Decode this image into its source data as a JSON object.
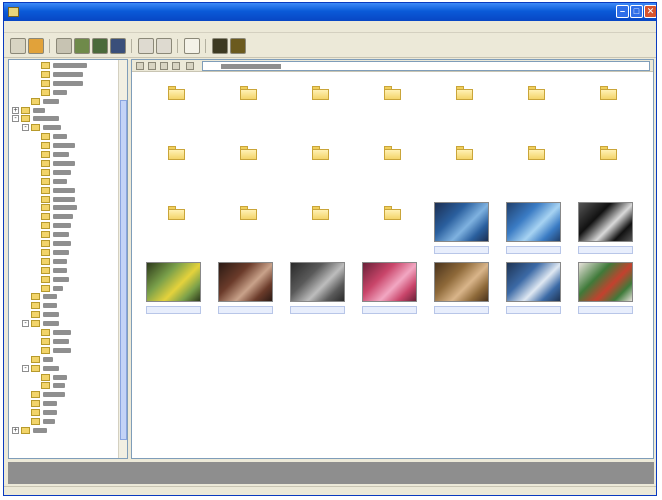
{
  "window": {
    "title": ""
  },
  "menu": [
    "",
    "",
    "",
    "",
    "",
    "",
    ""
  ],
  "address": {
    "path": ""
  },
  "tree": {
    "items": [
      {
        "depth": 3,
        "expander": ""
      },
      {
        "depth": 3,
        "expander": ""
      },
      {
        "depth": 3,
        "expander": ""
      },
      {
        "depth": 3,
        "expander": ""
      },
      {
        "depth": 2,
        "expander": ""
      },
      {
        "depth": 1,
        "expander": "+"
      },
      {
        "depth": 1,
        "expander": "-"
      },
      {
        "depth": 2,
        "expander": "-"
      },
      {
        "depth": 3,
        "expander": ""
      },
      {
        "depth": 3,
        "expander": ""
      },
      {
        "depth": 3,
        "expander": ""
      },
      {
        "depth": 3,
        "expander": ""
      },
      {
        "depth": 3,
        "expander": ""
      },
      {
        "depth": 3,
        "expander": ""
      },
      {
        "depth": 3,
        "expander": ""
      },
      {
        "depth": 3,
        "expander": ""
      },
      {
        "depth": 3,
        "expander": ""
      },
      {
        "depth": 3,
        "expander": ""
      },
      {
        "depth": 3,
        "expander": ""
      },
      {
        "depth": 3,
        "expander": ""
      },
      {
        "depth": 3,
        "expander": ""
      },
      {
        "depth": 3,
        "expander": ""
      },
      {
        "depth": 3,
        "expander": ""
      },
      {
        "depth": 3,
        "expander": ""
      },
      {
        "depth": 3,
        "expander": ""
      },
      {
        "depth": 3,
        "expander": ""
      },
      {
        "depth": 2,
        "expander": ""
      },
      {
        "depth": 2,
        "expander": ""
      },
      {
        "depth": 2,
        "expander": ""
      },
      {
        "depth": 2,
        "expander": "-"
      },
      {
        "depth": 3,
        "expander": ""
      },
      {
        "depth": 3,
        "expander": ""
      },
      {
        "depth": 3,
        "expander": ""
      },
      {
        "depth": 2,
        "expander": ""
      },
      {
        "depth": 2,
        "expander": "-"
      },
      {
        "depth": 3,
        "expander": ""
      },
      {
        "depth": 3,
        "expander": ""
      },
      {
        "depth": 2,
        "expander": ""
      },
      {
        "depth": 2,
        "expander": ""
      },
      {
        "depth": 2,
        "expander": ""
      },
      {
        "depth": 2,
        "expander": ""
      },
      {
        "depth": 1,
        "expander": "+"
      }
    ]
  },
  "files": [
    {
      "kind": "folder",
      "label": ""
    },
    {
      "kind": "folder",
      "label": ""
    },
    {
      "kind": "folder",
      "label": ""
    },
    {
      "kind": "folder",
      "label": ""
    },
    {
      "kind": "folder",
      "label": ""
    },
    {
      "kind": "folder",
      "label": ""
    },
    {
      "kind": "folder",
      "label": ""
    },
    {
      "kind": "folder",
      "label": ""
    },
    {
      "kind": "folder",
      "label": ""
    },
    {
      "kind": "folder",
      "label": ""
    },
    {
      "kind": "folder",
      "label": ""
    },
    {
      "kind": "folder",
      "label": ""
    },
    {
      "kind": "folder",
      "label": ""
    },
    {
      "kind": "folder",
      "label": ""
    },
    {
      "kind": "folder",
      "label": ""
    },
    {
      "kind": "folder",
      "label": ""
    },
    {
      "kind": "folder",
      "label": ""
    },
    {
      "kind": "folder",
      "label": ""
    },
    {
      "kind": "photo",
      "label": "",
      "colors": [
        "#2a5f9e",
        "#7fb2e0",
        "#1c2f52"
      ]
    },
    {
      "kind": "photo",
      "label": "",
      "colors": [
        "#3a7bc4",
        "#a7d3f2",
        "#20406c"
      ]
    },
    {
      "kind": "photo",
      "label": "",
      "colors": [
        "#111111",
        "#d9d9d9",
        "#555555"
      ]
    },
    {
      "kind": "photo",
      "label": "",
      "colors": [
        "#7aa04a",
        "#e4d23c",
        "#2d3a1b"
      ]
    },
    {
      "kind": "photo",
      "label": "",
      "colors": [
        "#6b3b2a",
        "#c9a28a",
        "#2b1a14"
      ]
    },
    {
      "kind": "photo",
      "label": "",
      "colors": [
        "#5a5a5a",
        "#bdbdbd",
        "#2a2a2a"
      ]
    },
    {
      "kind": "photo",
      "label": "",
      "colors": [
        "#c9456a",
        "#f2a7c2",
        "#6a2138"
      ]
    },
    {
      "kind": "photo",
      "label": "",
      "colors": [
        "#8f6a3a",
        "#d9b58a",
        "#4a331b"
      ]
    },
    {
      "kind": "photo",
      "label": "",
      "colors": [
        "#3c6aa6",
        "#dfe8f2",
        "#1e3454"
      ]
    },
    {
      "kind": "photo",
      "label": "",
      "colors": [
        "#3f7a3a",
        "#c4412e",
        "#e7e2da"
      ]
    }
  ],
  "status": {
    "text": ""
  },
  "theme": {
    "titlebar_blue": "#0a5ad8",
    "chrome": "#ece9d8",
    "selection_fill": "#e8eefc",
    "folder_yellow": "#f3d46a"
  }
}
